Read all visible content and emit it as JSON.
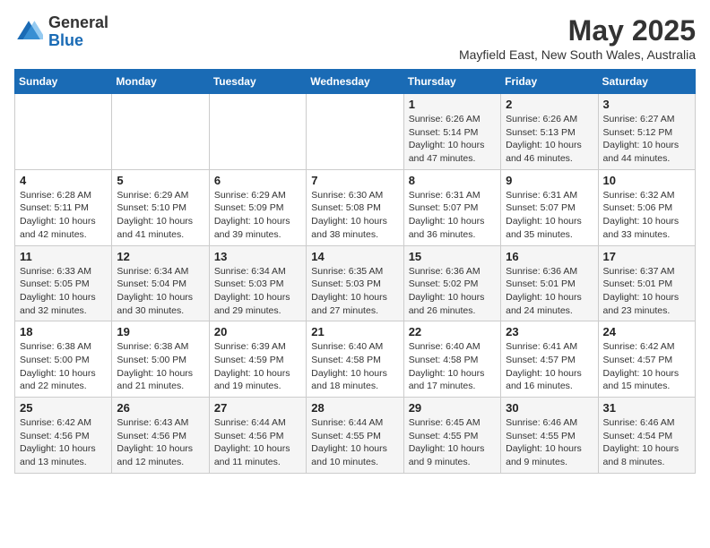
{
  "header": {
    "logo_general": "General",
    "logo_blue": "Blue",
    "month_title": "May 2025",
    "location": "Mayfield East, New South Wales, Australia"
  },
  "weekdays": [
    "Sunday",
    "Monday",
    "Tuesday",
    "Wednesday",
    "Thursday",
    "Friday",
    "Saturday"
  ],
  "weeks": [
    [
      {
        "day": "",
        "info": ""
      },
      {
        "day": "",
        "info": ""
      },
      {
        "day": "",
        "info": ""
      },
      {
        "day": "",
        "info": ""
      },
      {
        "day": "1",
        "info": "Sunrise: 6:26 AM\nSunset: 5:14 PM\nDaylight: 10 hours\nand 47 minutes."
      },
      {
        "day": "2",
        "info": "Sunrise: 6:26 AM\nSunset: 5:13 PM\nDaylight: 10 hours\nand 46 minutes."
      },
      {
        "day": "3",
        "info": "Sunrise: 6:27 AM\nSunset: 5:12 PM\nDaylight: 10 hours\nand 44 minutes."
      }
    ],
    [
      {
        "day": "4",
        "info": "Sunrise: 6:28 AM\nSunset: 5:11 PM\nDaylight: 10 hours\nand 42 minutes."
      },
      {
        "day": "5",
        "info": "Sunrise: 6:29 AM\nSunset: 5:10 PM\nDaylight: 10 hours\nand 41 minutes."
      },
      {
        "day": "6",
        "info": "Sunrise: 6:29 AM\nSunset: 5:09 PM\nDaylight: 10 hours\nand 39 minutes."
      },
      {
        "day": "7",
        "info": "Sunrise: 6:30 AM\nSunset: 5:08 PM\nDaylight: 10 hours\nand 38 minutes."
      },
      {
        "day": "8",
        "info": "Sunrise: 6:31 AM\nSunset: 5:07 PM\nDaylight: 10 hours\nand 36 minutes."
      },
      {
        "day": "9",
        "info": "Sunrise: 6:31 AM\nSunset: 5:07 PM\nDaylight: 10 hours\nand 35 minutes."
      },
      {
        "day": "10",
        "info": "Sunrise: 6:32 AM\nSunset: 5:06 PM\nDaylight: 10 hours\nand 33 minutes."
      }
    ],
    [
      {
        "day": "11",
        "info": "Sunrise: 6:33 AM\nSunset: 5:05 PM\nDaylight: 10 hours\nand 32 minutes."
      },
      {
        "day": "12",
        "info": "Sunrise: 6:34 AM\nSunset: 5:04 PM\nDaylight: 10 hours\nand 30 minutes."
      },
      {
        "day": "13",
        "info": "Sunrise: 6:34 AM\nSunset: 5:03 PM\nDaylight: 10 hours\nand 29 minutes."
      },
      {
        "day": "14",
        "info": "Sunrise: 6:35 AM\nSunset: 5:03 PM\nDaylight: 10 hours\nand 27 minutes."
      },
      {
        "day": "15",
        "info": "Sunrise: 6:36 AM\nSunset: 5:02 PM\nDaylight: 10 hours\nand 26 minutes."
      },
      {
        "day": "16",
        "info": "Sunrise: 6:36 AM\nSunset: 5:01 PM\nDaylight: 10 hours\nand 24 minutes."
      },
      {
        "day": "17",
        "info": "Sunrise: 6:37 AM\nSunset: 5:01 PM\nDaylight: 10 hours\nand 23 minutes."
      }
    ],
    [
      {
        "day": "18",
        "info": "Sunrise: 6:38 AM\nSunset: 5:00 PM\nDaylight: 10 hours\nand 22 minutes."
      },
      {
        "day": "19",
        "info": "Sunrise: 6:38 AM\nSunset: 5:00 PM\nDaylight: 10 hours\nand 21 minutes."
      },
      {
        "day": "20",
        "info": "Sunrise: 6:39 AM\nSunset: 4:59 PM\nDaylight: 10 hours\nand 19 minutes."
      },
      {
        "day": "21",
        "info": "Sunrise: 6:40 AM\nSunset: 4:58 PM\nDaylight: 10 hours\nand 18 minutes."
      },
      {
        "day": "22",
        "info": "Sunrise: 6:40 AM\nSunset: 4:58 PM\nDaylight: 10 hours\nand 17 minutes."
      },
      {
        "day": "23",
        "info": "Sunrise: 6:41 AM\nSunset: 4:57 PM\nDaylight: 10 hours\nand 16 minutes."
      },
      {
        "day": "24",
        "info": "Sunrise: 6:42 AM\nSunset: 4:57 PM\nDaylight: 10 hours\nand 15 minutes."
      }
    ],
    [
      {
        "day": "25",
        "info": "Sunrise: 6:42 AM\nSunset: 4:56 PM\nDaylight: 10 hours\nand 13 minutes."
      },
      {
        "day": "26",
        "info": "Sunrise: 6:43 AM\nSunset: 4:56 PM\nDaylight: 10 hours\nand 12 minutes."
      },
      {
        "day": "27",
        "info": "Sunrise: 6:44 AM\nSunset: 4:56 PM\nDaylight: 10 hours\nand 11 minutes."
      },
      {
        "day": "28",
        "info": "Sunrise: 6:44 AM\nSunset: 4:55 PM\nDaylight: 10 hours\nand 10 minutes."
      },
      {
        "day": "29",
        "info": "Sunrise: 6:45 AM\nSunset: 4:55 PM\nDaylight: 10 hours\nand 9 minutes."
      },
      {
        "day": "30",
        "info": "Sunrise: 6:46 AM\nSunset: 4:55 PM\nDaylight: 10 hours\nand 9 minutes."
      },
      {
        "day": "31",
        "info": "Sunrise: 6:46 AM\nSunset: 4:54 PM\nDaylight: 10 hours\nand 8 minutes."
      }
    ]
  ]
}
